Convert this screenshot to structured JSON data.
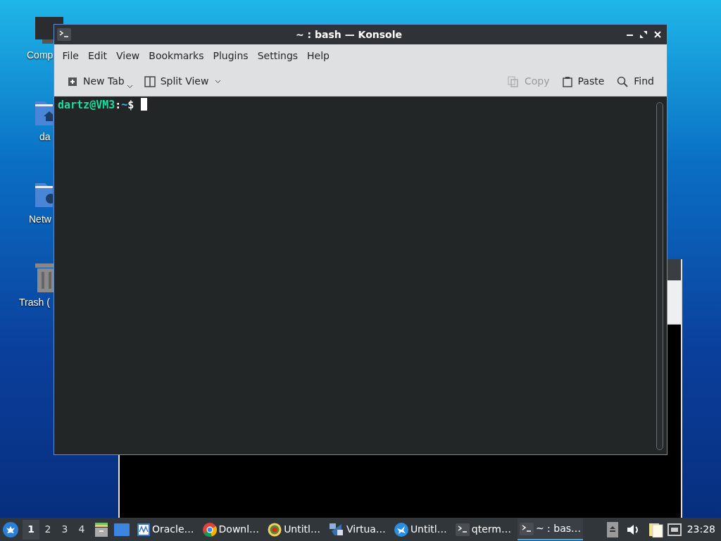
{
  "desktop_icons": [
    {
      "kind": "computer",
      "label": "Comp"
    },
    {
      "kind": "home",
      "label": "da"
    },
    {
      "kind": "network",
      "label": "Netw"
    },
    {
      "kind": "trash",
      "label": "Trash ("
    }
  ],
  "window": {
    "title": "~ : bash — Konsole"
  },
  "menu": [
    "File",
    "Edit",
    "View",
    "Bookmarks",
    "Plugins",
    "Settings",
    "Help"
  ],
  "toolbar": {
    "left": [
      {
        "kind": "new-tab",
        "label": "New Tab",
        "disabled": false
      },
      {
        "kind": "split",
        "label": "Split View",
        "disabled": false
      }
    ],
    "right": [
      {
        "kind": "copy",
        "label": "Copy",
        "disabled": true
      },
      {
        "kind": "paste",
        "label": "Paste",
        "disabled": false
      },
      {
        "kind": "find",
        "label": "Find",
        "disabled": false
      }
    ]
  },
  "terminal": {
    "user_host": "dartz@VM3",
    "separator": ":",
    "path": "~",
    "prompt": "$"
  },
  "taskbar": {
    "desktops": [
      {
        "label": "1",
        "selected": true
      },
      {
        "label": "2",
        "selected": false
      },
      {
        "label": "3",
        "selected": false
      },
      {
        "label": "4",
        "selected": false
      }
    ],
    "tasks": [
      {
        "kind": "monitor",
        "label": "Oracle…",
        "selected": false
      },
      {
        "kind": "browser",
        "label": "Downl…",
        "selected": false
      },
      {
        "kind": "target",
        "label": "Untitl…",
        "selected": false
      },
      {
        "kind": "virtualbox",
        "label": "Virtua…",
        "selected": false
      },
      {
        "kind": "bird",
        "label": "Untitl…",
        "selected": false
      },
      {
        "kind": "terminal",
        "label": "qterm…",
        "selected": false
      },
      {
        "kind": "terminal",
        "label": "~ : bas…",
        "selected": true
      }
    ],
    "clock": "23:28"
  }
}
